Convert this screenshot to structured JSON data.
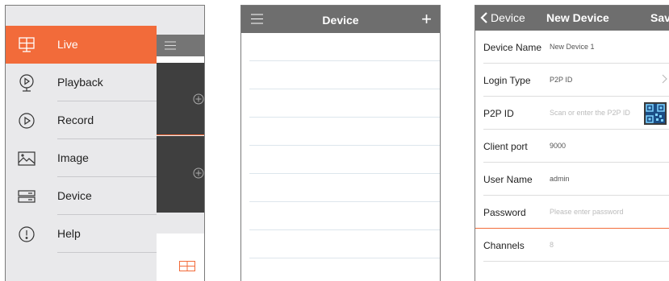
{
  "menu_panel": {
    "items": [
      {
        "label": "Live",
        "icon": "live-grid-icon",
        "active": true
      },
      {
        "label": "Playback",
        "icon": "playback-icon",
        "active": false
      },
      {
        "label": "Record",
        "icon": "record-icon",
        "active": false
      },
      {
        "label": "Image",
        "icon": "image-icon",
        "active": false
      },
      {
        "label": "Device",
        "icon": "device-icon",
        "active": false
      },
      {
        "label": "Help",
        "icon": "help-icon",
        "active": false
      }
    ],
    "accent_color": "#f26b3a"
  },
  "device_panel": {
    "title": "Device",
    "add_label": "+"
  },
  "new_device_panel": {
    "back_label": "Device",
    "title": "New Device",
    "save_label": "Save",
    "fields": [
      {
        "label": "Device Name",
        "value": "New Device 1",
        "placeholder": false
      },
      {
        "label": "Login Type",
        "value": "P2P ID",
        "placeholder": false
      },
      {
        "label": "P2P ID",
        "value": "Scan or enter the P2P ID",
        "placeholder": true
      },
      {
        "label": "Client port",
        "value": "9000",
        "placeholder": false
      },
      {
        "label": "User Name",
        "value": "admin",
        "placeholder": false
      },
      {
        "label": "Password",
        "value": "Please enter password",
        "placeholder": true
      },
      {
        "label": "Channels",
        "value": "8",
        "placeholder": true
      }
    ]
  }
}
